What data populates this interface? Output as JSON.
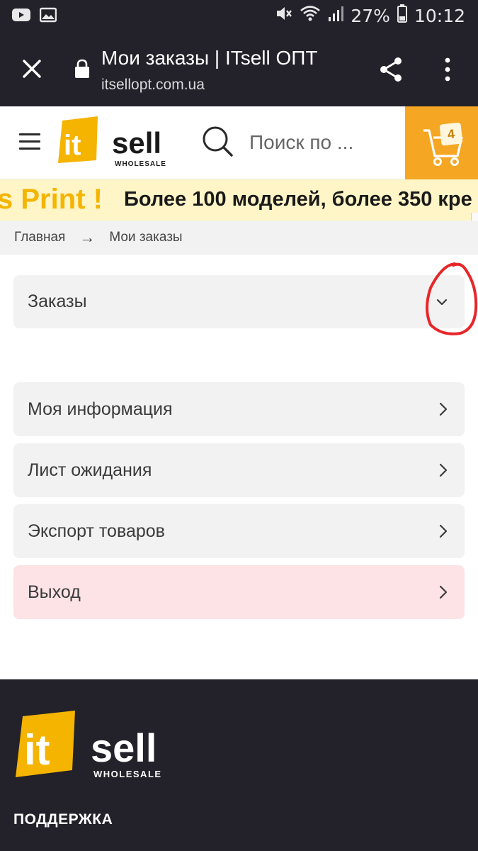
{
  "status_bar": {
    "battery": "27%",
    "time": "10:12"
  },
  "browser": {
    "title": "Мои заказы | ITsell ОПТ",
    "url": "itsellopt.com.ua"
  },
  "header": {
    "logo_it": "it",
    "logo_sell": "sell",
    "logo_sub": "WHOLESALE",
    "search_placeholder": "Поиск по ...",
    "cart_count": "4",
    "accent_color": "#f5a623"
  },
  "promo": {
    "print": "s Print !",
    "text": "Более 100 моделей, более 350 кре"
  },
  "breadcrumb": {
    "home": "Главная",
    "arrow": "→",
    "current": "Мои заказы"
  },
  "account_menu": {
    "orders_label": "Заказы",
    "items": [
      {
        "label": "Моя информация"
      },
      {
        "label": "Лист ожидания"
      },
      {
        "label": "Экспорт товаров"
      },
      {
        "label": "Выход"
      }
    ]
  },
  "footer": {
    "logo_it": "it",
    "logo_sell": "sell",
    "logo_sub": "WHOLESALE",
    "support_heading": "ПОДДЕРЖКА"
  }
}
